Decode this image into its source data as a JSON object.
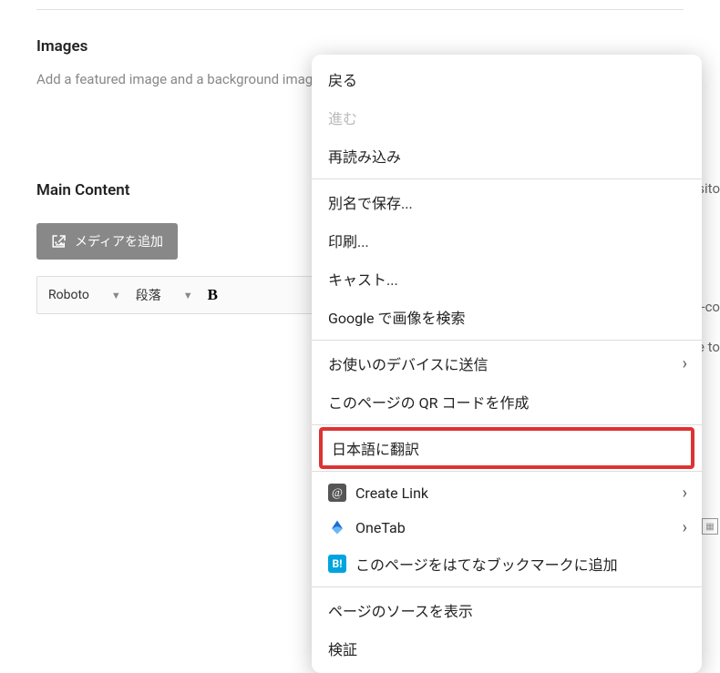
{
  "sections": {
    "images": {
      "title": "Images",
      "desc": "Add a featured image and a background image to your pop-up."
    },
    "main_content": {
      "title": "Main Content",
      "media_button": "メディアを追加",
      "font_select": "Roboto",
      "block_select": "段落",
      "bold": "B"
    }
  },
  "truncated": {
    "r1": "visito",
    "r2": "p-co",
    "r3": "e to"
  },
  "context_menu": {
    "back": "戻る",
    "forward": "進む",
    "reload": "再読み込み",
    "save_as": "別名で保存...",
    "print": "印刷...",
    "cast": "キャスト...",
    "google_image_search": "Google で画像を検索",
    "send_to_device": "お使いのデバイスに送信",
    "create_qr": "このページの QR コードを作成",
    "translate_jp": "日本語に翻訳",
    "create_link": "Create Link",
    "onetab": "OneTab",
    "hatena": "このページをはてなブックマークに追加",
    "view_source": "ページのソースを表示",
    "inspect": "検証"
  }
}
